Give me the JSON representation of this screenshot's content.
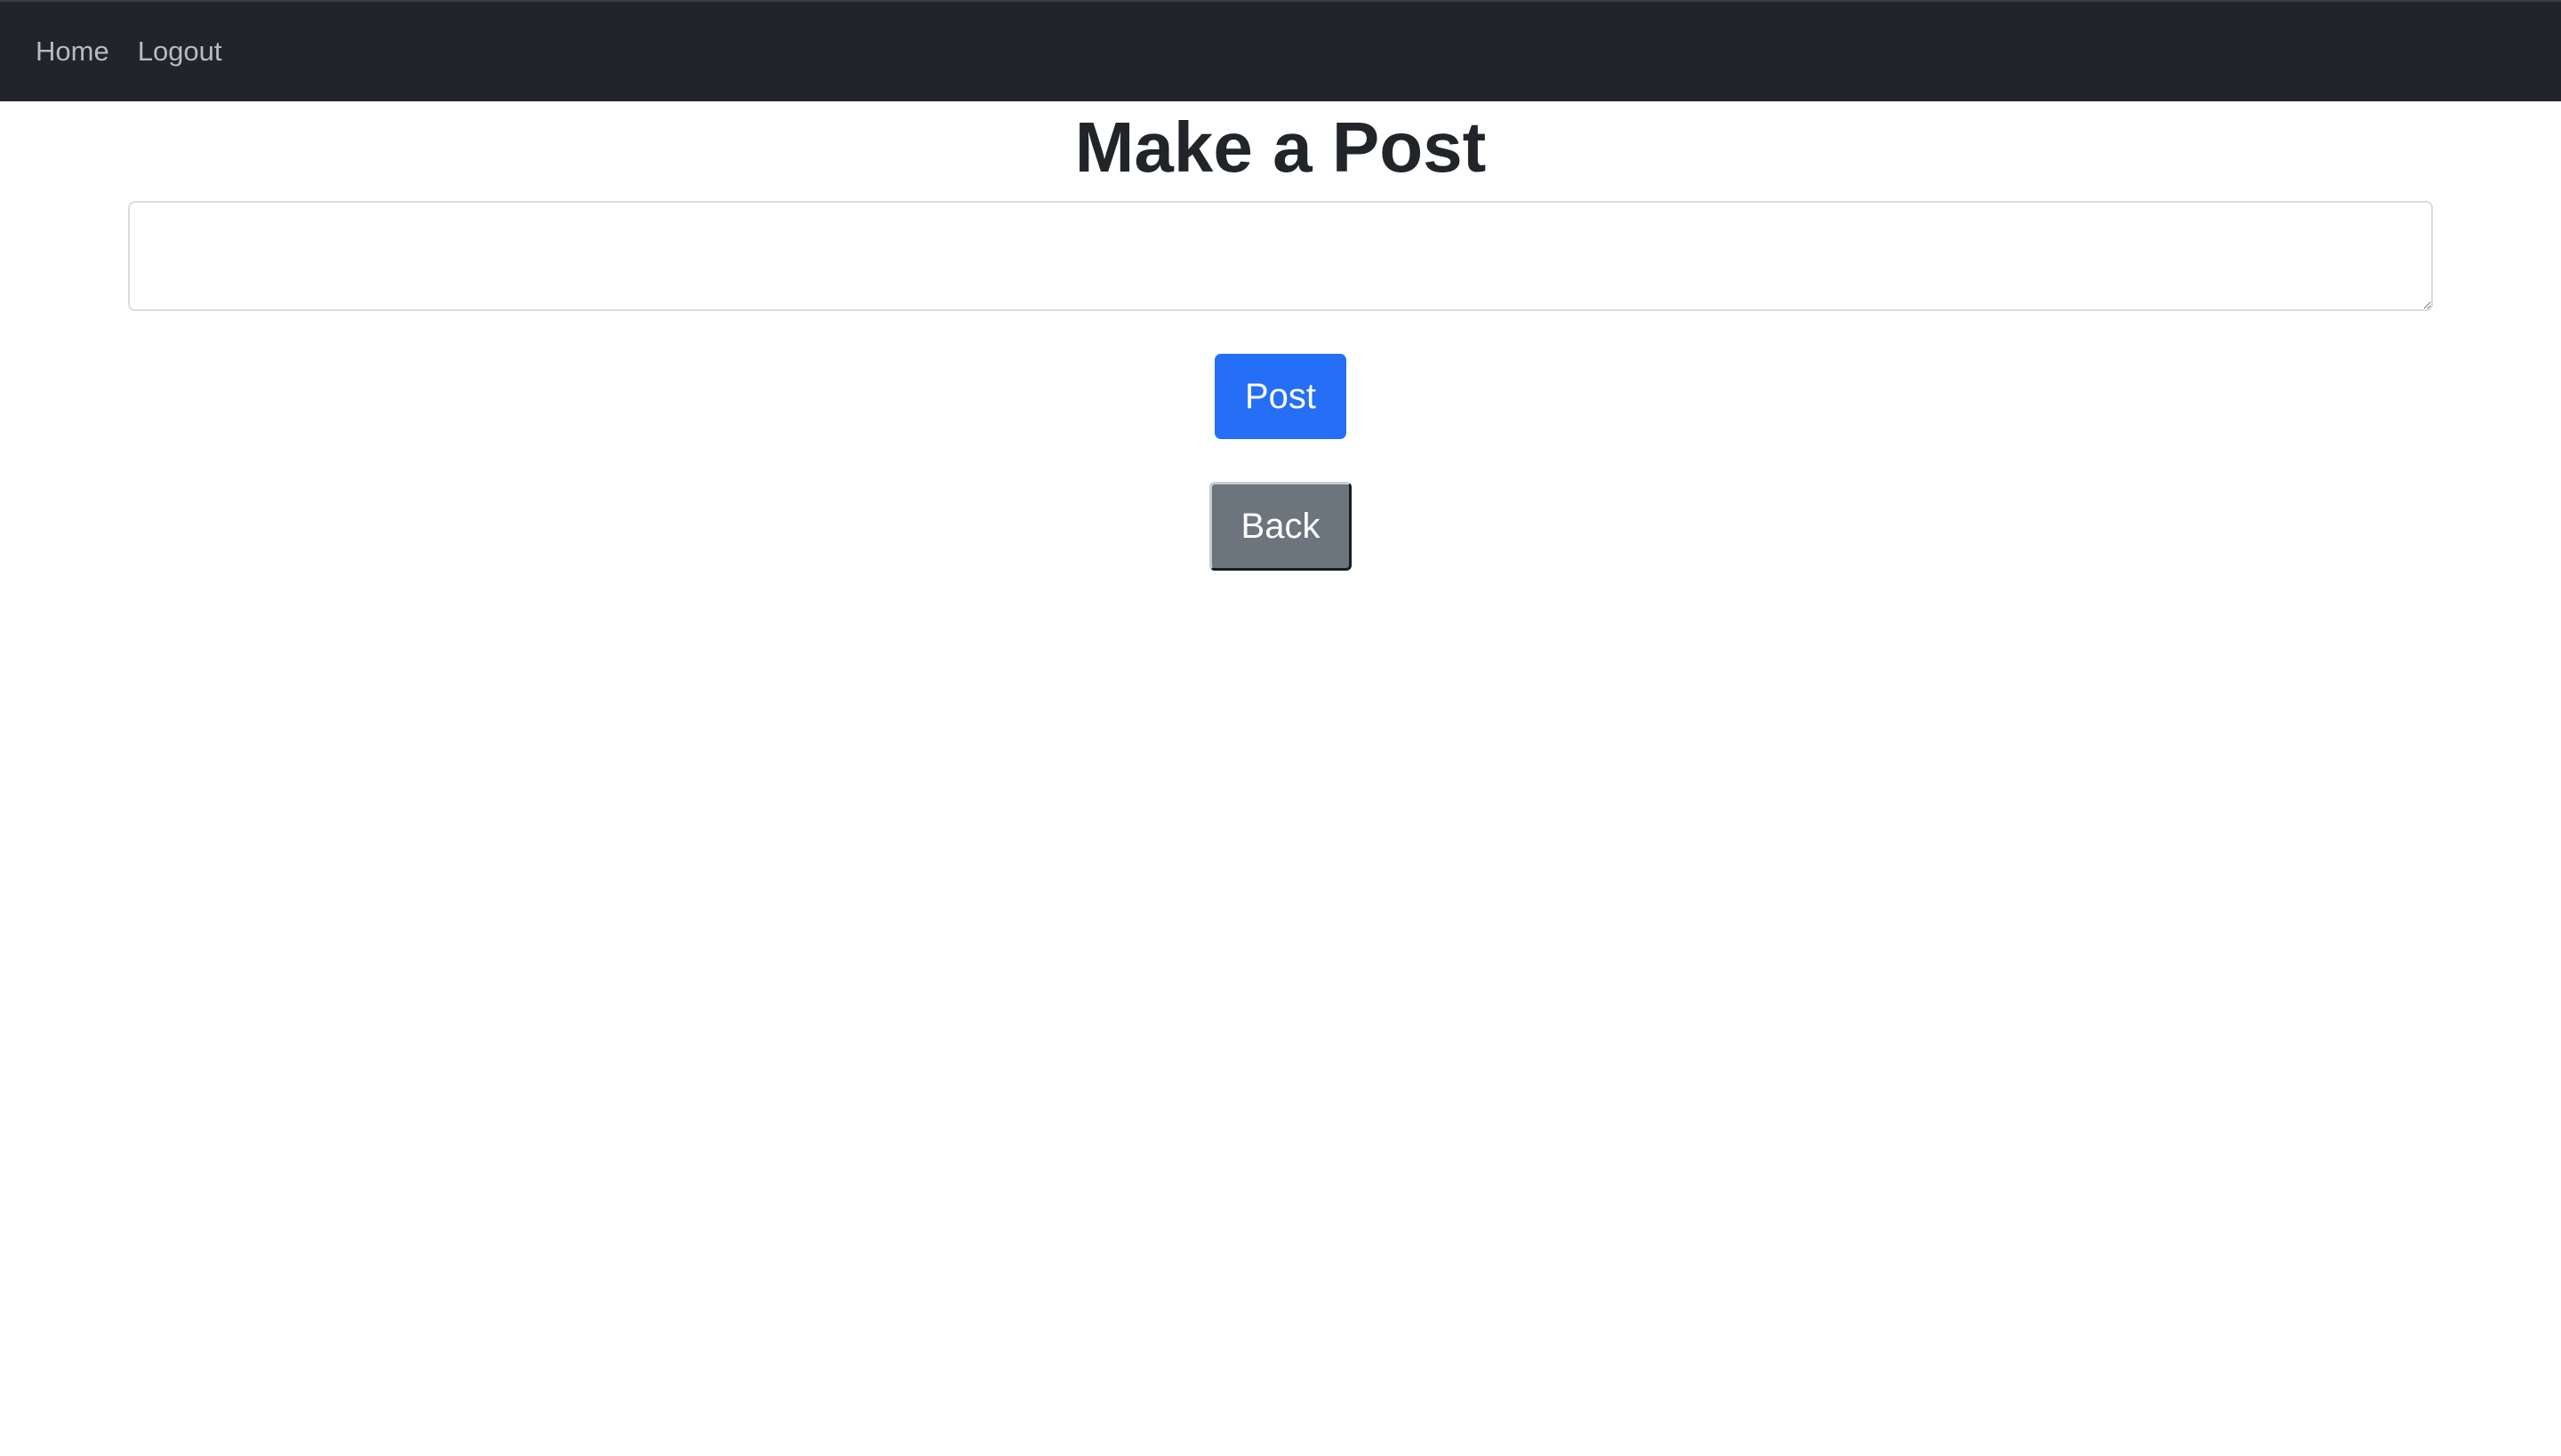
{
  "nav": {
    "home_label": "Home",
    "logout_label": "Logout"
  },
  "page": {
    "title": "Make a Post"
  },
  "form": {
    "textarea_value": "",
    "post_label": "Post",
    "back_label": "Back"
  },
  "colors": {
    "navbar_bg": "#212529",
    "post_button": "#246ff5",
    "back_button": "#6c757d"
  }
}
